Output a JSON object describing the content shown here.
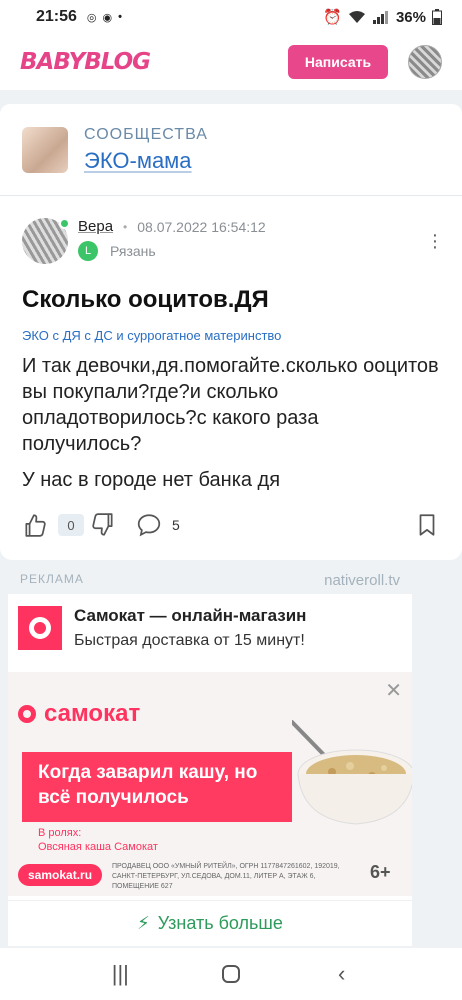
{
  "status_bar": {
    "time": "21:56",
    "battery": "36%"
  },
  "header": {
    "logo": "BABYBLOG",
    "write_button": "Написать"
  },
  "community": {
    "kicker": "СООБЩЕСТВА",
    "name": "ЭКО-мама"
  },
  "post": {
    "author": "Вера",
    "date": "08.07.2022 16:54:12",
    "city": "Рязань",
    "title": "Сколько ооцитов.ДЯ",
    "tag": "ЭКО с ДЯ с ДС и суррогатное материнство",
    "body": "И так девочки,дя.помогайте.сколько ооцитов вы покупали?где?и сколько опладотворилось?с какого раза получилось?",
    "body2": "У нас в городе нет банка дя",
    "likes": "0",
    "comments": "5"
  },
  "ad": {
    "label": "РЕКЛАМА",
    "source": "nativeroll.tv",
    "advertiser": "Самокат — онлайн-магазин",
    "description": "Быстрая доставка от 15 минут!",
    "banner_brand": "самокат",
    "banner_slogan": "Когда заварил кашу, но всё получилось",
    "banner_role_1": "В ролях:",
    "banner_role_2": "Овсяная каша Самокат",
    "banner_url": "samokat.ru",
    "banner_legal": "ПРОДАВЕЦ ООО «УМНЫЙ РИТЕЙЛ», ОГРН 1177847261602, 192019, САНКТ-ПЕТЕРБУРГ, УЛ.СЕДОВА, ДОМ.11, ЛИТЕР А, ЭТАЖ 6, ПОМЕЩЕНИЕ 627",
    "banner_age": "6+",
    "cta": "Узнать больше"
  },
  "colors": {
    "brand_pink": "#e9478c",
    "link_blue": "#2a6ec4",
    "samokat_red": "#ff335f",
    "cta_green": "#2e9a5b"
  }
}
